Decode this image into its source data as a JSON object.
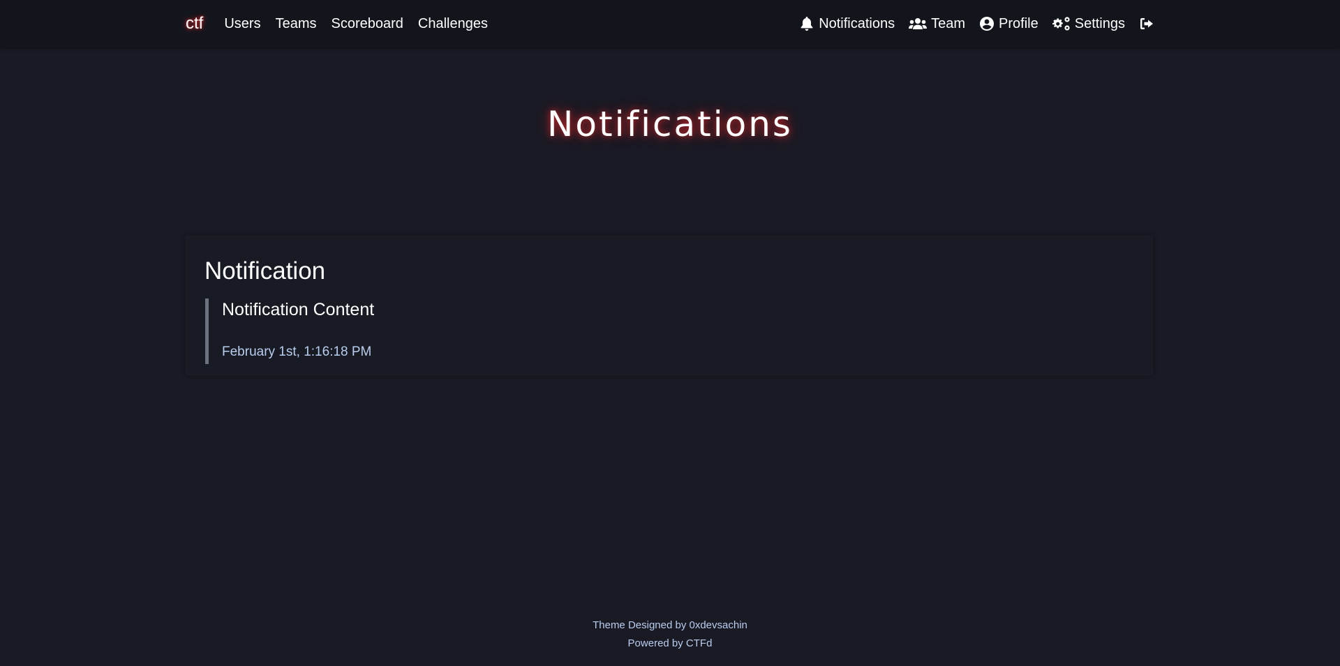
{
  "navbar": {
    "brand": "ctf",
    "left_links": [
      "Users",
      "Teams",
      "Scoreboard",
      "Challenges"
    ],
    "right_links": {
      "notifications": "Notifications",
      "team": "Team",
      "profile": "Profile",
      "settings": "Settings"
    },
    "icons": {
      "notifications": "bell-icon",
      "team": "users-icon",
      "profile": "user-circle-icon",
      "settings": "gears-icon",
      "logout": "sign-out-icon"
    }
  },
  "page": {
    "title": "Notifications"
  },
  "notifications": [
    {
      "title": "Notification",
      "content": "Notification Content",
      "date": "February 1st, 1:16:18 PM"
    }
  ],
  "footer": {
    "theme_credit": "Theme Designed by 0xdevsachin",
    "powered_by": "Powered by CTFd"
  },
  "colors": {
    "background": "#191a24",
    "navbar": "#13151d",
    "glow": "#ff2828",
    "link_blue": "#b9cdee",
    "quote_border": "#6c727f"
  }
}
